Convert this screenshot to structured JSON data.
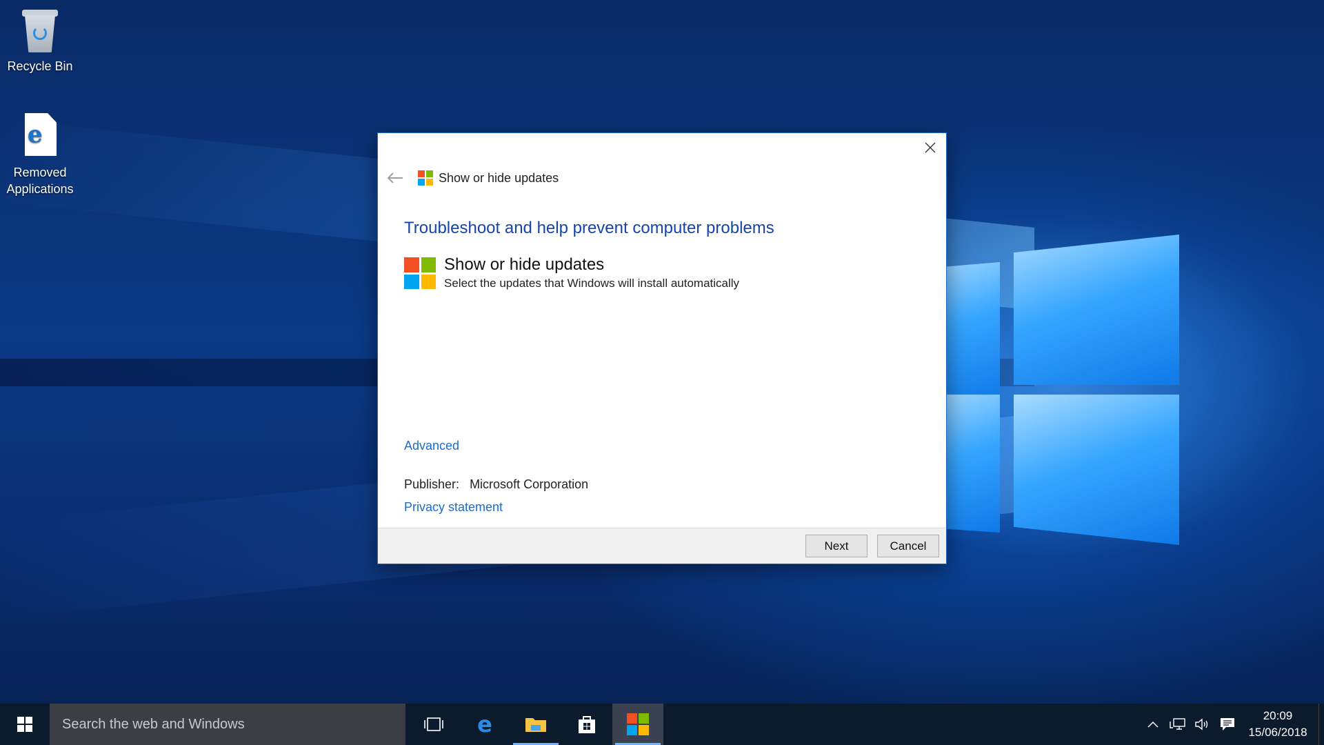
{
  "desktop": {
    "icons": [
      {
        "label": "Recycle Bin",
        "icon": "recycle-bin-icon"
      },
      {
        "label": "Removed Applications",
        "icon": "edge-document-icon"
      }
    ]
  },
  "dialog": {
    "nav_title": "Show or hide updates",
    "heading": "Troubleshoot and help prevent computer problems",
    "item_title": "Show or hide updates",
    "item_subtitle": "Select the updates that Windows will install automatically",
    "advanced_link": "Advanced",
    "publisher_label": "Publisher:",
    "publisher_value": "Microsoft Corporation",
    "privacy_link": "Privacy statement",
    "next_label": "Next",
    "cancel_label": "Cancel"
  },
  "taskbar": {
    "search_placeholder": "Search the web and Windows",
    "apps": [
      {
        "name": "task-view",
        "icon": "task-view-icon"
      },
      {
        "name": "edge",
        "icon": "edge-icon"
      },
      {
        "name": "file-explorer",
        "icon": "folder-icon"
      },
      {
        "name": "store",
        "icon": "store-icon"
      },
      {
        "name": "troubleshooter",
        "icon": "windows-logo-icon"
      }
    ],
    "clock_time": "20:09",
    "clock_date": "15/06/2018"
  },
  "colors": {
    "logo_red": "#f25022",
    "logo_green": "#7fba00",
    "logo_blue": "#00a4ef",
    "logo_yellow": "#ffb900",
    "link": "#1a6dcc",
    "heading": "#1545a8"
  }
}
